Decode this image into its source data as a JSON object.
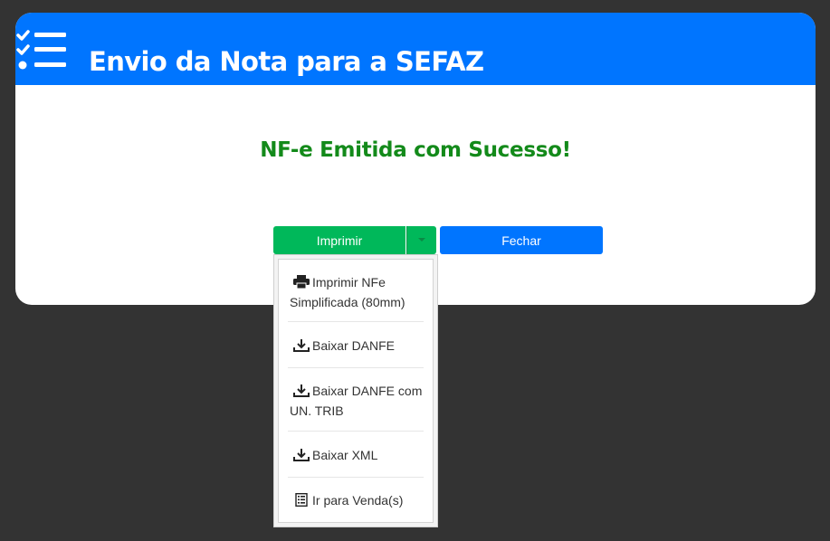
{
  "modal": {
    "title": "Envio da Nota para a SEFAZ",
    "header_icon": "checklist-icon",
    "header_color": "#0075ff"
  },
  "message": {
    "text": "NF-e Emitida com Sucesso!",
    "color": "#138a1a"
  },
  "buttons": {
    "print_label": "Imprimir",
    "close_label": "Fechar",
    "print_color": "#00b85a",
    "close_color": "#0075ff"
  },
  "dropdown": {
    "items": [
      {
        "label": "Imprimir NFe Simplificada (80mm)",
        "icon": "printer-icon"
      },
      {
        "label": "Baixar DANFE",
        "icon": "download-icon"
      },
      {
        "label": "Baixar DANFE com UN. TRIB",
        "icon": "download-icon"
      },
      {
        "label": "Baixar XML",
        "icon": "download-icon"
      },
      {
        "label": "Ir para Venda(s)",
        "icon": "receipt-icon"
      }
    ]
  }
}
